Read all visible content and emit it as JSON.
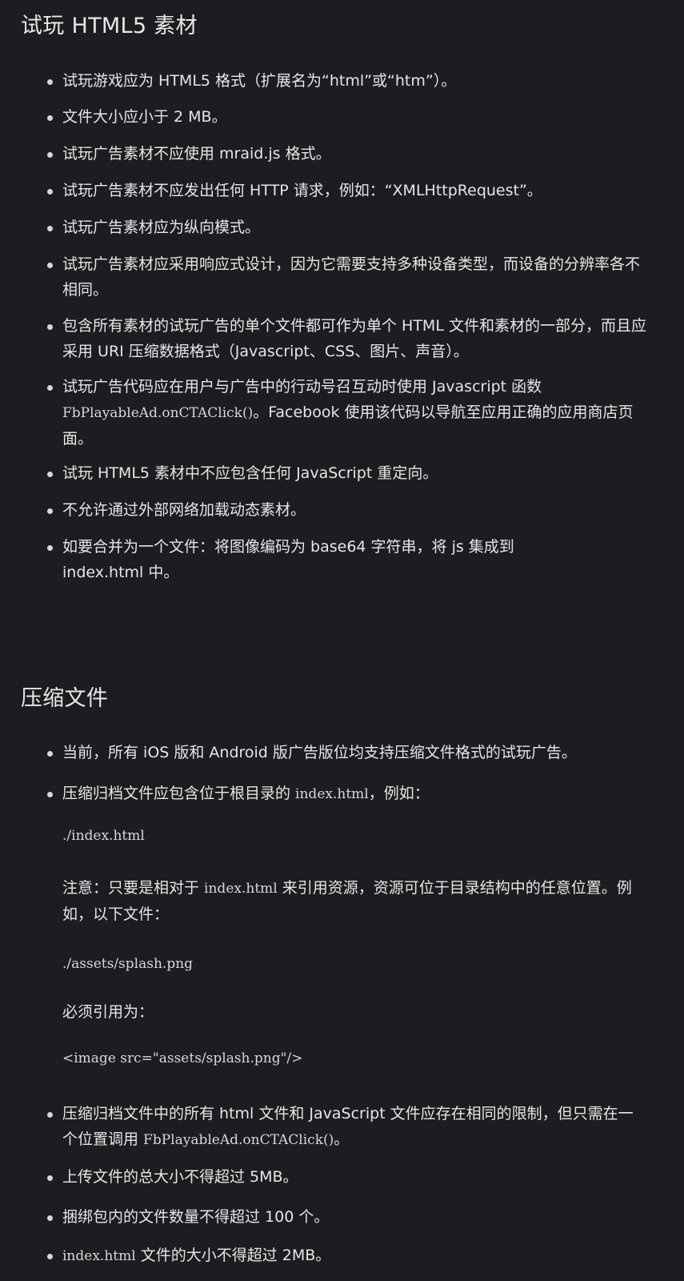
{
  "section1": {
    "title": "试玩 HTML5 素材",
    "items": {
      "i1": "试玩游戏应为 HTML5 格式（扩展名为“html”或“htm”）。",
      "i2": "文件大小应小于 2 MB。",
      "i3": "试玩广告素材不应使用 mraid.js 格式。",
      "i4": "试玩广告素材不应发出任何 HTTP 请求，例如：“XMLHttpRequest”。",
      "i5": "试玩广告素材应为纵向模式。",
      "i6": "试玩广告素材应采用响应式设计，因为它需要支持多种设备类型，而设备的分辨率各不相同。",
      "i7": "包含所有素材的试玩广告的单个文件都可作为单个 HTML 文件和素材的一部分，而且应采用 URI 压缩数据格式（Javascript、CSS、图片、声音）。",
      "i8_pre": "试玩广告代码应在用户与广告中的行动号召互动时使用 Javascript 函数 ",
      "i8_code": "FbPlayableAd.onCTAClick()",
      "i8_post": "。Facebook 使用该代码以导航至应用正确的应用商店页面。",
      "i9": "试玩 HTML5 素材中不应包含任何 JavaScript 重定向。",
      "i10": "不允许通过外部网络加载动态素材。",
      "i11": "如要合并为一个文件：将图像编码为 base64 字符串，将 js 集成到 index.html 中。"
    }
  },
  "section2": {
    "title": "压缩文件",
    "b1": "当前，所有 iOS 版和 Android 版广告版位均支持压缩文件格式的试玩广告。",
    "b2_pre": "压缩归档文件应包含位于根目录的 ",
    "b2_code": "index.html",
    "b2_post": "，例如：",
    "code1": "./index.html",
    "note_pre": "注意：只要是相对于 ",
    "note_code": "index.html",
    "note_post": " 来引用资源，资源可位于目录结构中的任意位置。例如，以下文件：",
    "code2": "./assets/splash.png",
    "must": "必须引用为：",
    "code3": "<image src=\"assets/splash.png\"/>",
    "b3_pre": "压缩归档文件中的所有 html 文件和 JavaScript 文件应存在相同的限制，但只需在一个位置调用 ",
    "b3_code": "FbPlayableAd.onCTAClick()",
    "b3_post": "。",
    "b4": "上传文件的总大小不得超过 5MB。",
    "b5": "捆绑包内的文件数量不得超过 100 个。",
    "b6_code": "index.html",
    "b6_post": " 文件的大小不得超过 2MB。"
  }
}
